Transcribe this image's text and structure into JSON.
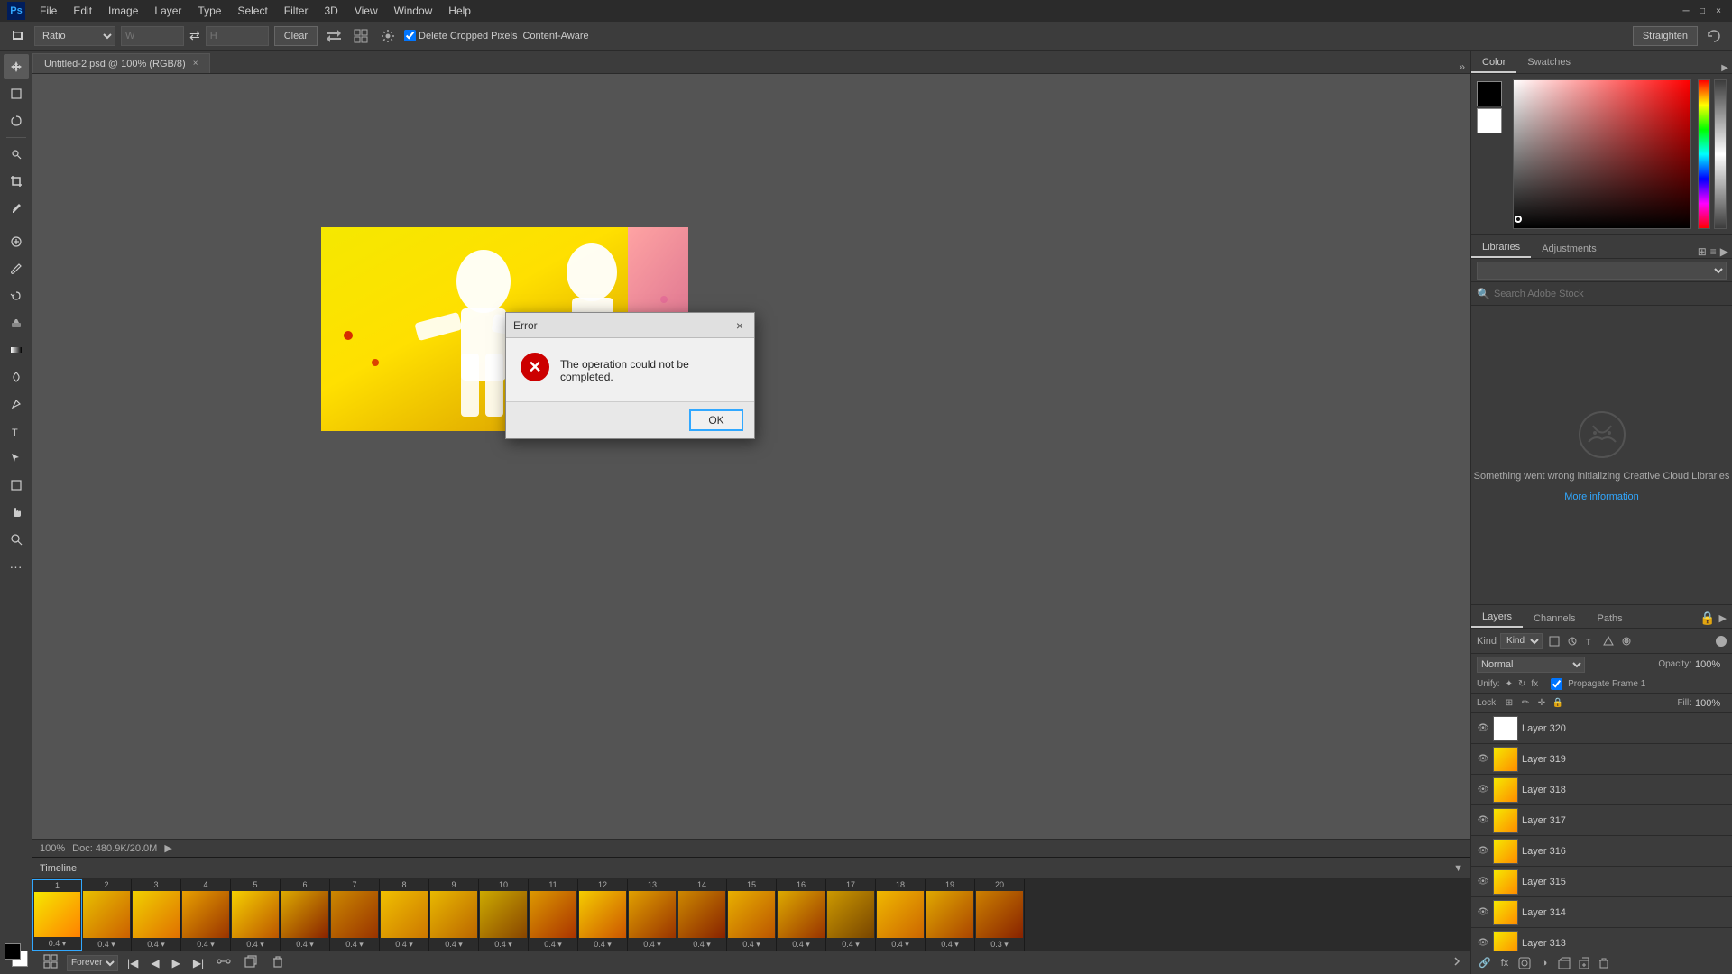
{
  "app": {
    "title": "Photoshop",
    "logo": "Ps"
  },
  "menu": {
    "items": [
      "File",
      "Edit",
      "Image",
      "Layer",
      "Type",
      "Select",
      "Filter",
      "3D",
      "View",
      "Window",
      "Help"
    ]
  },
  "options_bar": {
    "ratio_label": "Ratio",
    "clear_btn": "Clear",
    "straighten_btn": "Straighten",
    "delete_cropped_label": "Delete Cropped Pixels",
    "content_aware_label": "Content-Aware",
    "swap_icon": "⇄"
  },
  "document": {
    "title": "Untitled-2.psd @ 100% (RGB/8)",
    "close_label": "×"
  },
  "canvas": {
    "zoom": "100%",
    "doc_size": "Doc: 480.9K/20.0M"
  },
  "color_panel": {
    "tabs": [
      "Color",
      "Swatches"
    ],
    "active_tab": "Color"
  },
  "libraries_panel": {
    "tabs": [
      "Libraries",
      "Adjustments"
    ],
    "active_tab": "Libraries",
    "error_text": "Something went wrong initializing Creative Cloud Libraries",
    "more_info": "More information",
    "search_placeholder": "Search Adobe Stock"
  },
  "layers_panel": {
    "tabs": [
      "Layers",
      "Channels",
      "Paths"
    ],
    "active_tab": "Layers",
    "blend_mode": "Normal",
    "opacity_label": "Opacity:",
    "opacity_value": "100%",
    "lock_label": "Lock:",
    "fill_label": "Fill:",
    "fill_value": "100%",
    "unify_label": "Unify:",
    "propagate_label": "Propagate Frame 1",
    "layers": [
      {
        "name": "Layer 320",
        "thumb": "white",
        "visible": true
      },
      {
        "name": "Layer 319",
        "thumb": "yellow",
        "visible": true
      },
      {
        "name": "Layer 318",
        "thumb": "yellow",
        "visible": true
      },
      {
        "name": "Layer 317",
        "thumb": "yellow",
        "visible": true
      },
      {
        "name": "Layer 316",
        "thumb": "yellow",
        "visible": true
      },
      {
        "name": "Layer 315",
        "thumb": "yellow",
        "visible": true
      },
      {
        "name": "Layer 314",
        "thumb": "yellow",
        "visible": true
      },
      {
        "name": "Layer 313",
        "thumb": "yellow",
        "visible": true
      }
    ]
  },
  "timeline": {
    "title": "Timeline",
    "loop_label": "Forever",
    "frames": [
      {
        "num": "1",
        "dur": "0.4 ▾"
      },
      {
        "num": "2",
        "dur": "0.4 ▾"
      },
      {
        "num": "3",
        "dur": "0.4 ▾"
      },
      {
        "num": "4",
        "dur": "0.4 ▾"
      },
      {
        "num": "5",
        "dur": "0.4 ▾"
      },
      {
        "num": "6",
        "dur": "0.4 ▾"
      },
      {
        "num": "7",
        "dur": "0.4 ▾"
      },
      {
        "num": "8",
        "dur": "0.4 ▾"
      },
      {
        "num": "9",
        "dur": "0.4 ▾"
      },
      {
        "num": "10",
        "dur": "0.4 ▾"
      },
      {
        "num": "11",
        "dur": "0.4 ▾"
      },
      {
        "num": "12",
        "dur": "0.4 ▾"
      },
      {
        "num": "13",
        "dur": "0.4 ▾"
      },
      {
        "num": "14",
        "dur": "0.4 ▾"
      },
      {
        "num": "15",
        "dur": "0.4 ▾"
      },
      {
        "num": "16",
        "dur": "0.4 ▾"
      },
      {
        "num": "17",
        "dur": "0.4 ▾"
      },
      {
        "num": "18",
        "dur": "0.4 ▾"
      },
      {
        "num": "19",
        "dur": "0.4 ▾"
      },
      {
        "num": "20",
        "dur": "0.3 ▾"
      }
    ]
  },
  "dialog": {
    "title": "Error",
    "message": "The operation could not be completed.",
    "ok_label": "OK",
    "close_icon": "×",
    "error_symbol": "✕"
  }
}
